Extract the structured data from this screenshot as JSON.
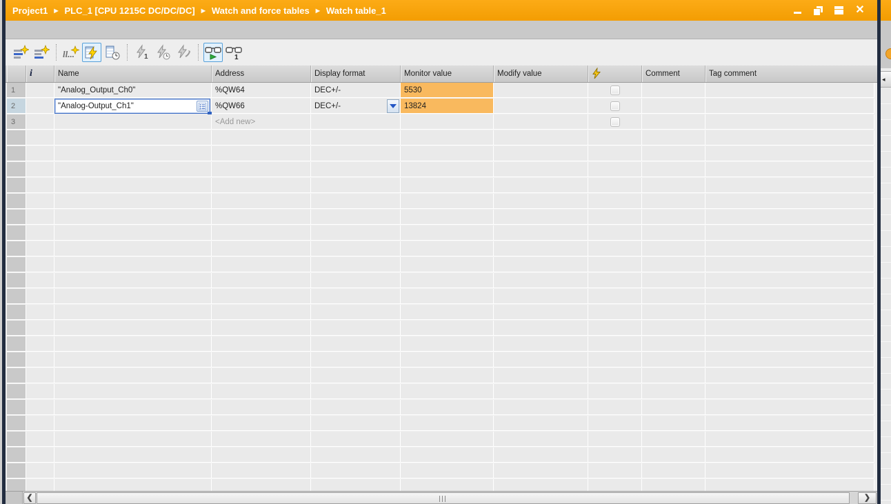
{
  "title_bar": {
    "separator": "▶",
    "breadcrumb": [
      {
        "label": "Project1"
      },
      {
        "label": "PLC_1 [CPU 1215C DC/DC/DC]"
      },
      {
        "label": "Watch and force tables"
      },
      {
        "label": "Watch table_1"
      }
    ],
    "close_glyph": "✕"
  },
  "toolbar": {
    "buttons": [
      {
        "icon": "insert-row-icon",
        "state": "normal"
      },
      {
        "icon": "add-row-icon",
        "state": "normal"
      },
      {
        "icon": "insert-comment-line-icon",
        "state": "normal"
      },
      {
        "icon": "monitor-all-icon",
        "state": "active"
      },
      {
        "icon": "monitor-once-icon",
        "state": "normal"
      },
      {
        "icon": "modify-once-icon",
        "state": "disabled"
      },
      {
        "icon": "modify-with-trigger-icon",
        "state": "disabled"
      },
      {
        "icon": "enable-peripheral-outputs-icon",
        "state": "disabled"
      },
      {
        "icon": "show-modify-columns-icon",
        "state": "active"
      },
      {
        "icon": "show-force-columns-icon",
        "state": "normal"
      }
    ]
  },
  "table": {
    "headers": {
      "row_index": "",
      "info": "i",
      "name": "Name",
      "address": "Address",
      "display_format": "Display format",
      "monitor_value": "Monitor value",
      "modify_value": "Modify value",
      "modify_trigger_icon": "lightning-icon",
      "comment": "Comment",
      "tag_comment": "Tag comment"
    },
    "rows": [
      {
        "num": "1",
        "name": "\"Analog_Output_Ch0\"",
        "address": "%QW64",
        "display_format": "DEC+/-",
        "monitor_value": "5530",
        "modify_value": "",
        "comment": "",
        "tag_comment": ""
      },
      {
        "num": "2",
        "name": "\"Analog-Output_Ch1\"",
        "address": "%QW66",
        "display_format": "DEC+/-",
        "monitor_value": "13824",
        "modify_value": "",
        "comment": "",
        "tag_comment": "",
        "selected": true,
        "editing": true
      },
      {
        "num": "3",
        "address_placeholder": "<Add new>"
      }
    ],
    "empty_row_count": 23
  },
  "scrollbar": {
    "orientation": "horizontal",
    "left_arrow": "❮",
    "right_arrow": "❯"
  },
  "right_panel": {
    "collapse_arrow": "◂"
  },
  "colors": {
    "title_bar_orange": "#F9A40B",
    "monitor_value_highlight": "#F9B95E",
    "selected_row_header": "#C6D6E0",
    "accent_blue": "#2F62C1",
    "lightning_yellow": "#F4C400"
  }
}
